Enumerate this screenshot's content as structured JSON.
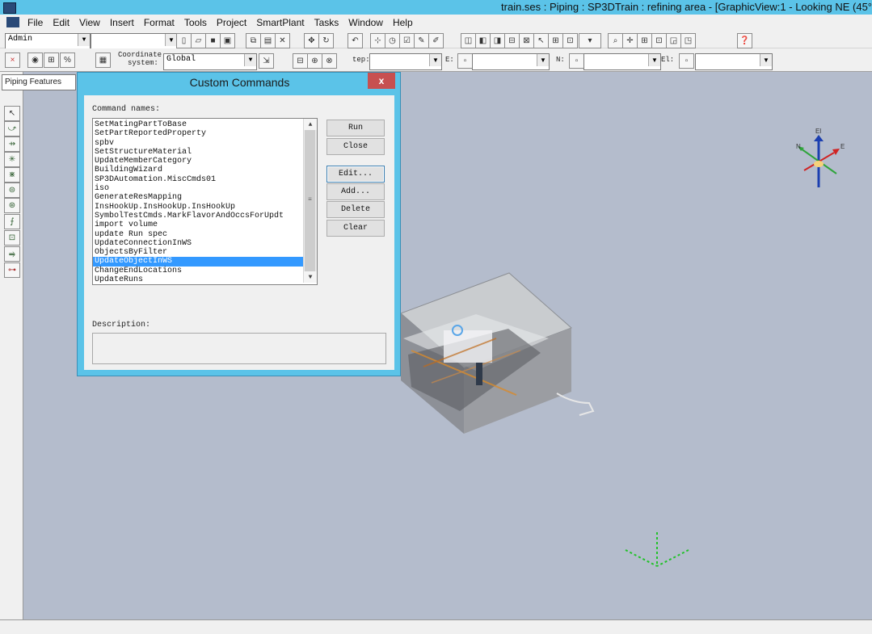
{
  "window": {
    "title": "train.ses : Piping : SP3DTrain : refining area - [GraphicView:1 - Looking NE (45°"
  },
  "menu": {
    "items": [
      "File",
      "Edit",
      "View",
      "Insert",
      "Format",
      "Tools",
      "Project",
      "SmartPlant",
      "Tasks",
      "Window",
      "Help"
    ]
  },
  "toolbar1": {
    "role_combo": "Admin",
    "second_combo": "",
    "icons": [
      "new-icon",
      "open-icon",
      "save-icon",
      "print-icon",
      "copy-icon",
      "paste-icon",
      "delete-icon",
      "move-icon",
      "rotate-icon",
      "undo-icon",
      "help-icon"
    ]
  },
  "toolbar2": {
    "coordinate_label_top": "Coordinate",
    "coordinate_label_bottom": "system:",
    "coordinate_value": "Global",
    "step_label": "tep:",
    "e_label": "E:",
    "n_label": "N:",
    "el_label": "El:",
    "step_value": "",
    "e_value": "",
    "n_value": "",
    "el_value": ""
  },
  "palette": {
    "label": "Piping Features",
    "tools": [
      "select-icon",
      "route-icon",
      "insert-component-icon",
      "insert-specialty-icon",
      "insert-tap-icon",
      "insert-instrument-icon",
      "insert-support-icon",
      "insert-split-icon",
      "insert-spool-icon",
      "insert-feature-icon",
      "connect-icon"
    ]
  },
  "dialog": {
    "title": "Custom Commands",
    "close_glyph": "x",
    "command_names_label": "Command names:",
    "commands": [
      "SetMatingPartToBase",
      "SetPartReportedProperty",
      "spbv",
      "SetStructureMaterial",
      "UpdateMemberCategory",
      "BuildingWizard",
      "SP3DAutomation.MiscCmds01",
      "iso",
      "GenerateResMapping",
      "InsHookUp.InsHookUp.InsHookUp",
      "SymbolTestCmds.MarkFlavorAndOccsForUpdt",
      "import volume",
      "update Run spec",
      "UpdateConnectionInWS",
      "ObjectsByFilter",
      "UpdateObjectInWS",
      "ChangeEndLocations",
      "UpdateRuns"
    ],
    "selected_index": 15,
    "buttons": {
      "run": "Run",
      "close": "Close",
      "edit": "Edit...",
      "add": "Add...",
      "delete": "Delete",
      "clear": "Clear"
    },
    "description_label": "Description:",
    "description_value": ""
  },
  "compass": {
    "labels": {
      "el": "El",
      "n": "N",
      "e": "E"
    }
  },
  "colors": {
    "titlebar": "#5bc3e8",
    "viewport": "#b4bccc",
    "selection": "#3399ff",
    "close_button": "#c75050"
  }
}
